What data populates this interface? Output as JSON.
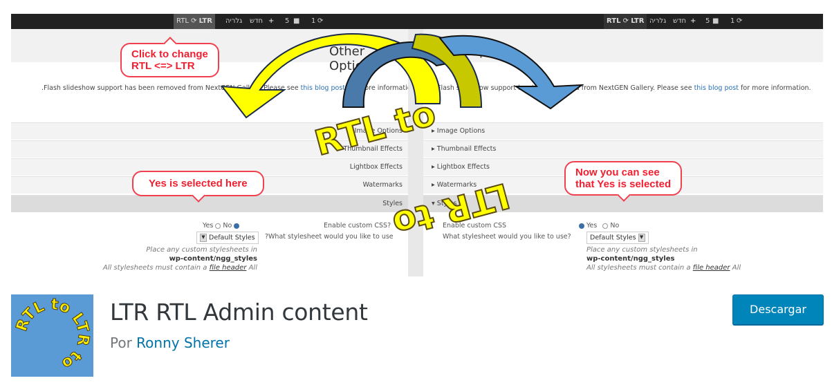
{
  "banner": {
    "admin_bar": {
      "toggle_rtl": "RTL",
      "toggle_ltr": "LTR",
      "toggle_icon": "refresh-icon",
      "item_hebrew_1": "גלריה",
      "item_hebrew_2": "חדש",
      "comments_count": "5",
      "updates_count": "1"
    },
    "rtl_panel": {
      "title": "Other Options",
      "info_text": ".Flash slideshow support has been removed from NextGEN Gallery. Please see",
      "info_link": "this blog post",
      "info_tail": "for more information",
      "sections": [
        "Image Options",
        "Thumbnail Effects",
        "Lightbox Effects",
        "Watermarks",
        "Styles"
      ],
      "enable_label": "Enable custom CSS?",
      "stylesheet_label": "?What stylesheet would you like to use",
      "yes": "Yes",
      "no": "No",
      "select_value": "Default Styles",
      "help_1": "Place any custom stylesheets in",
      "help_path": "wp-content/ngg_styles",
      "help_2": "All stylesheets must contain a",
      "help_link": "file header",
      "help_3": "All",
      "help_4": "stylesheets must contain a",
      "help_link_2": "file header"
    },
    "ltr_panel": {
      "title": "Other Options",
      "info_text": "Flash slideshow support has been removed from NextGEN Gallery. Please see",
      "info_link": "this blog post",
      "info_tail": "for more information.",
      "sections": [
        "Image Options",
        "Thumbnail Effects",
        "Lightbox Effects",
        "Watermarks",
        "Styles"
      ],
      "enable_label": "Enable custom CSS",
      "stylesheet_label": "What stylesheet would you like to use?",
      "yes": "Yes",
      "no": "No",
      "select_value": "Default Styles",
      "help_1": "Place any custom stylesheets in",
      "help_path": "wp-content/ngg_styles",
      "help_2": "All stylesheets must contain a",
      "help_link": "file header",
      "help_3": "All",
      "help_4": "stylesheets must contain a",
      "help_link_2": "file header"
    },
    "callouts": {
      "click_change": [
        "Click to change",
        "RTL <=> LTR"
      ],
      "yes_here": "Yes is selected here",
      "now_see": [
        "Now you can see",
        "that Yes is selected"
      ]
    },
    "wordart": {
      "top": "RTL to",
      "bottom": "LTR to"
    },
    "colors": {
      "arrow_yellow": "#ffff00",
      "arrow_olive": "#c8c800",
      "arrow_blue": "#5b9bd5",
      "arrow_dark_blue": "#4a7aaa",
      "callout_red": "#f02030"
    }
  },
  "plugin": {
    "icon_text": "RTL to LTR to",
    "title": "LTR RTL Admin content",
    "author_prefix": "Por",
    "author": "Ronny Sherer",
    "download_label": "Descargar",
    "accent": "#0085ba"
  }
}
